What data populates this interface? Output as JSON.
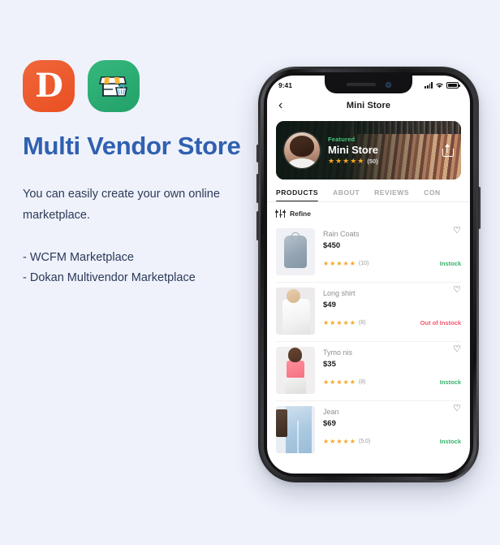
{
  "promo": {
    "logos": [
      {
        "name": "dokan-logo",
        "glyph": "D",
        "color": "#ed5d2c"
      },
      {
        "name": "store-logo",
        "glyph": "storefront",
        "color": "#2bab73"
      }
    ],
    "headline": "Multi Vendor Store",
    "description": "You can easily create your own online marketplace.",
    "bullets": [
      "- WCFM Marketplace",
      "- Dokan Multivendor Marketplace"
    ],
    "headline_color": "#3060b0",
    "background_color": "#eff2fb"
  },
  "phone": {
    "status_bar": {
      "time": "9:41",
      "signal_icon": "cellular-bars-icon",
      "wifi_icon": "wifi-icon",
      "battery_icon": "battery-full-icon"
    },
    "navbar": {
      "back_icon": "chevron-left-icon",
      "back_glyph": "‹",
      "title": "Mini Store"
    },
    "banner": {
      "badge": "Featured",
      "store_name": "Mini Store",
      "stars": "★★★★★",
      "rating_count": "(50)",
      "share_icon": "share-icon",
      "avatar_icon": "store-avatar",
      "badge_color": "#44c97a"
    },
    "tabs": [
      {
        "label": "PRODUCTS",
        "active": true
      },
      {
        "label": "ABOUT",
        "active": false
      },
      {
        "label": "REVIEWS",
        "active": false
      },
      {
        "label": "CON",
        "active": false
      }
    ],
    "refine": {
      "icon": "filter-sliders-icon",
      "label": "Refine"
    },
    "products": [
      {
        "name": "Rain Coats",
        "price": "$450",
        "stars": "★★★★★",
        "rating_count": "(10)",
        "stock": "Instock",
        "stock_state": "in",
        "favorite_icon": "heart-outline-icon",
        "favorite_glyph": "♡",
        "thumb": "thumb-coat"
      },
      {
        "name": "Long shirt",
        "price": "$49",
        "stars": "★★★★★",
        "rating_count": "(8)",
        "stock": "Out of Instock",
        "stock_state": "out",
        "favorite_icon": "heart-outline-icon",
        "favorite_glyph": "♡",
        "thumb": "thumb-shirt"
      },
      {
        "name": "Tymo nis",
        "price": "$35",
        "stars": "★★★★★",
        "rating_count": "(8)",
        "stock": "Instock",
        "stock_state": "in",
        "favorite_icon": "heart-outline-icon",
        "favorite_glyph": "♡",
        "thumb": "thumb-top"
      },
      {
        "name": "Jean",
        "price": "$69",
        "stars": "★★★★★",
        "rating_count": "(5.0)",
        "stock": "Instock",
        "stock_state": "in",
        "favorite_icon": "heart-outline-icon",
        "favorite_glyph": "♡",
        "thumb": "thumb-jean"
      }
    ]
  }
}
